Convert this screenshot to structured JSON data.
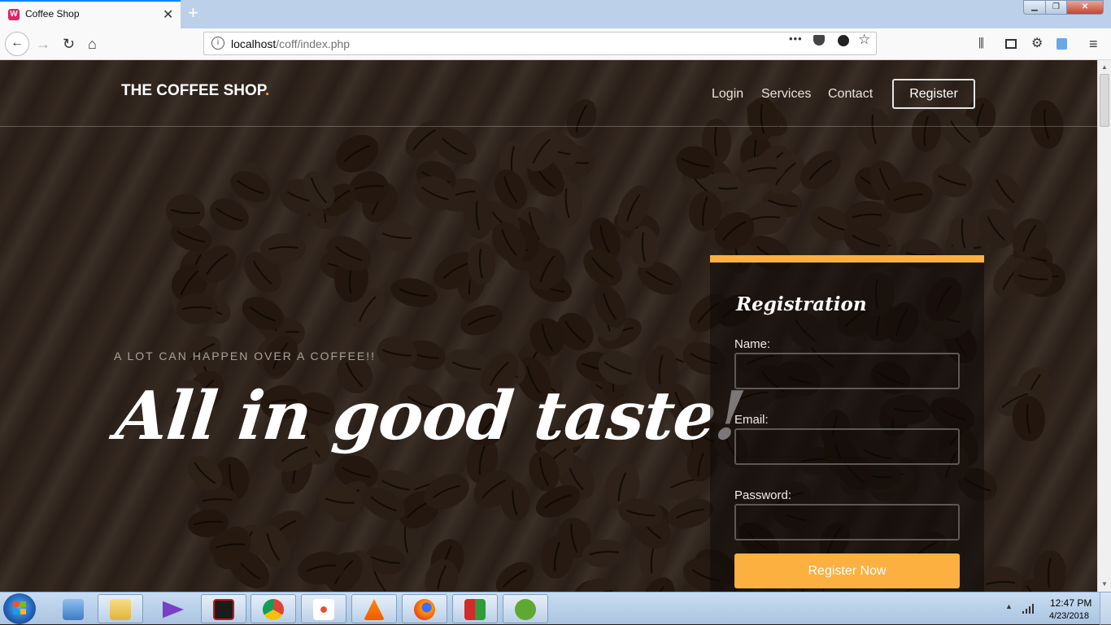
{
  "browser": {
    "tab_title": "Coffee Shop",
    "tab_close": "✕",
    "new_tab": "+",
    "url_host": "localhost",
    "url_path": "/coff/index.php",
    "page_actions": "•••",
    "icons": [
      "back-arrow",
      "forward-arrow",
      "reload",
      "home",
      "info",
      "pocket",
      "bookmark-star",
      "library",
      "sidebar",
      "settings",
      "sync",
      "menu"
    ]
  },
  "site": {
    "brand": "THE COFFEE SHOP",
    "brand_dot": ".",
    "nav": {
      "login": "Login",
      "services": "Services",
      "contact": "Contact",
      "register": "Register"
    },
    "hero": {
      "tagline": "A LOT CAN HAPPEN OVER A COFFEE!!",
      "headline": "All in good taste!"
    },
    "registration": {
      "title": "Registration",
      "name_label": "Name:",
      "email_label": "Email:",
      "password_label": "Password:",
      "name_value": "",
      "email_value": "",
      "password_value": "",
      "submit_label": "Register Now"
    },
    "colors": {
      "accent": "#fbb040",
      "brand_dot": "#f5a623"
    }
  },
  "taskbar": {
    "apps": [
      "control-panel",
      "file-explorer",
      "visual-studio",
      "pdf-reader",
      "chrome",
      "app-grid",
      "vlc",
      "firefox",
      "winrar",
      "utorrent"
    ],
    "time": "12:47 PM",
    "date": "4/23/2018"
  }
}
